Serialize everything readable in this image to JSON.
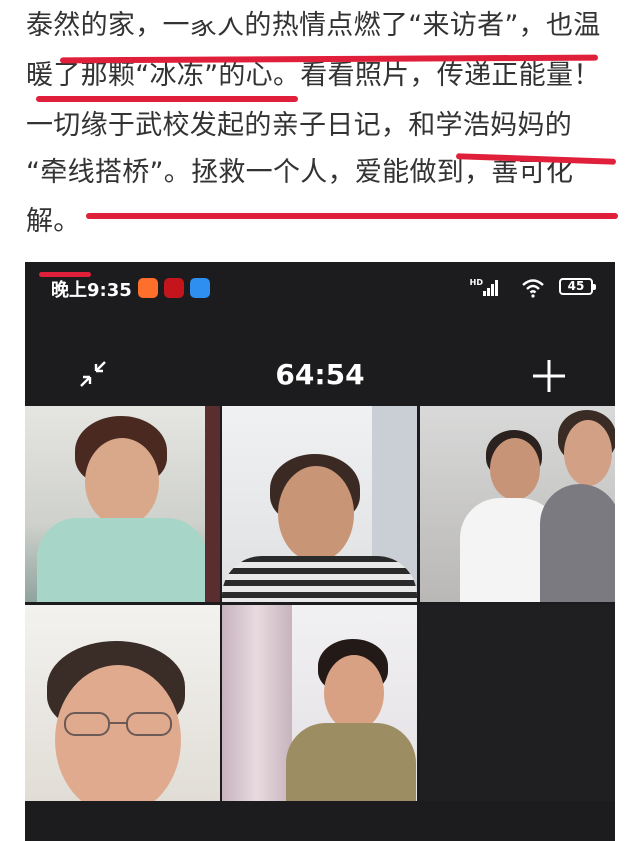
{
  "article": {
    "line1": "泰然的家，一家人的热情点燃了“来访者”，也温",
    "line2": "暖了那颗“冰冻”的心。看看照片，传递正能量！",
    "line3": "一切缘于武校发起的亲子日记，和学浩妈妈的",
    "line4": "“牵线搭桥”。拯救一个人，爱能做到，善可化",
    "line5": "解。",
    "highlight_color": "#e01f3a"
  },
  "phone": {
    "status_time": "晚上9:35",
    "app_icons": [
      "taobao-icon",
      "red-app-icon",
      "blue-app-icon"
    ],
    "network_label": "HD",
    "battery_level": "45",
    "call_timer": "64:54",
    "participants": [
      {
        "label": "participant-1"
      },
      {
        "label": "participant-2"
      },
      {
        "label": "participant-3-pair"
      },
      {
        "label": "participant-4"
      },
      {
        "label": "participant-5"
      }
    ]
  }
}
